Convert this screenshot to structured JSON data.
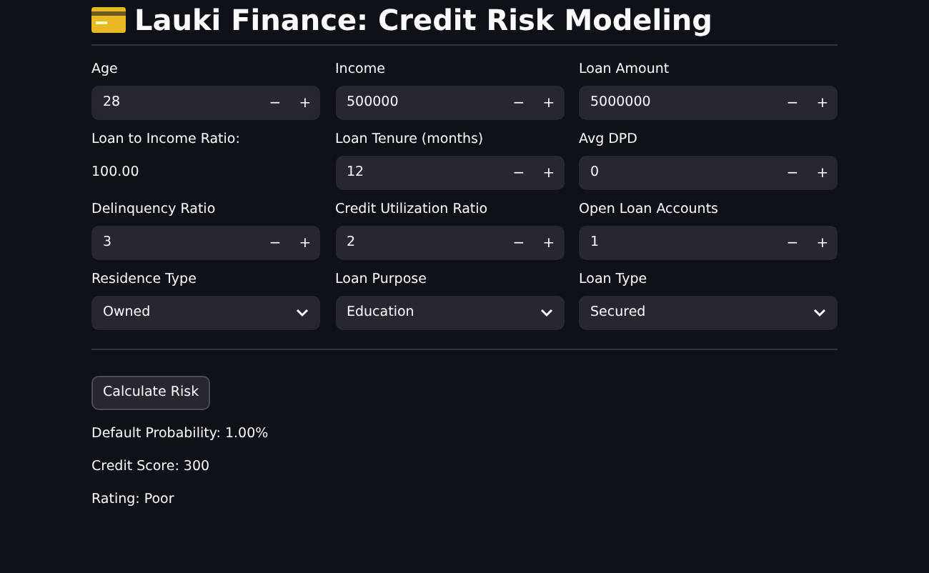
{
  "title": "Lauki Finance: Credit Risk Modeling",
  "fields": [
    {
      "kind": "number",
      "label": "Age",
      "value": "28",
      "decrement": "−",
      "increment": "+"
    },
    {
      "kind": "number",
      "label": "Income",
      "value": "500000",
      "decrement": "−",
      "increment": "+"
    },
    {
      "kind": "number",
      "label": "Loan Amount",
      "value": "5000000",
      "decrement": "−",
      "increment": "+"
    },
    {
      "kind": "static",
      "label": "Loan to Income Ratio:",
      "value": "100.00"
    },
    {
      "kind": "number",
      "label": "Loan Tenure (months)",
      "value": "12",
      "decrement": "−",
      "increment": "+"
    },
    {
      "kind": "number",
      "label": "Avg DPD",
      "value": "0",
      "decrement": "−",
      "increment": "+"
    },
    {
      "kind": "number",
      "label": "Delinquency Ratio",
      "value": "3",
      "decrement": "−",
      "increment": "+"
    },
    {
      "kind": "number",
      "label": "Credit Utilization Ratio",
      "value": "2",
      "decrement": "−",
      "increment": "+"
    },
    {
      "kind": "number",
      "label": "Open Loan Accounts",
      "value": "1",
      "decrement": "−",
      "increment": "+"
    },
    {
      "kind": "select",
      "label": "Residence Type",
      "value": "Owned"
    },
    {
      "kind": "select",
      "label": "Loan Purpose",
      "value": "Education"
    },
    {
      "kind": "select",
      "label": "Loan Type",
      "value": "Secured"
    }
  ],
  "button": "Calculate Risk",
  "results": [
    "Default Probability: 1.00%",
    "Credit Score: 300",
    "Rating: Poor"
  ]
}
